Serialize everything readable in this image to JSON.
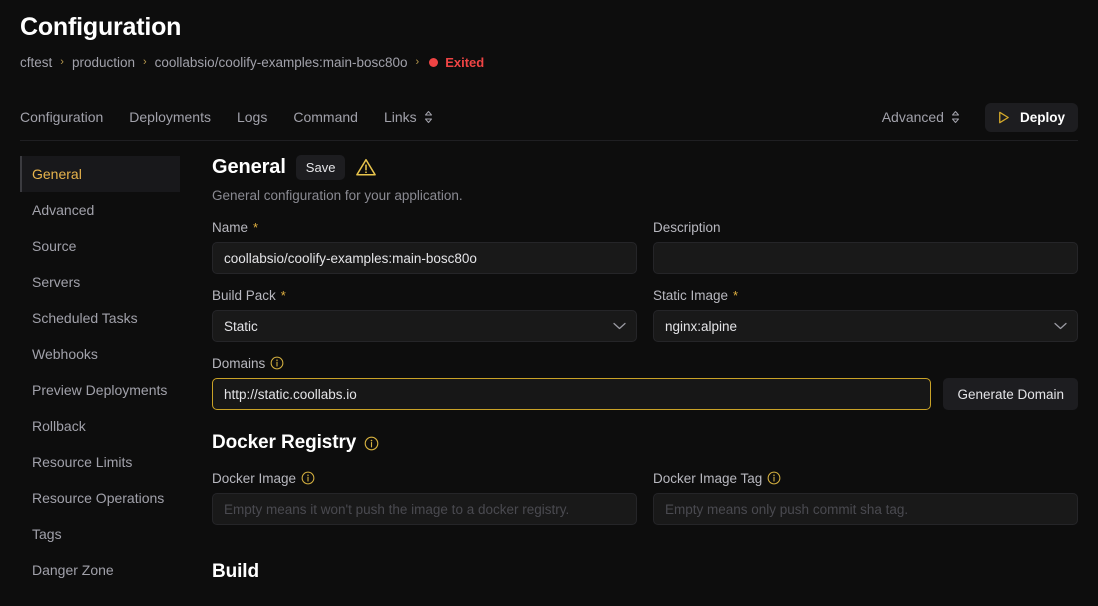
{
  "header": {
    "title": "Configuration",
    "breadcrumb": [
      {
        "label": "cftest"
      },
      {
        "label": "production"
      },
      {
        "label": "coollabsio/coolify-examples:main-bosc80o"
      }
    ],
    "separator": "›",
    "status": {
      "label": "Exited",
      "color": "#ef4444"
    }
  },
  "tabbar": {
    "tabs": [
      {
        "label": "Configuration",
        "active": true
      },
      {
        "label": "Deployments",
        "active": false
      },
      {
        "label": "Logs",
        "active": false
      },
      {
        "label": "Command",
        "active": false
      },
      {
        "label": "Links",
        "active": false,
        "icon": "chevron-updown-icon"
      }
    ],
    "advanced": {
      "label": "Advanced",
      "icon": "chevron-updown-icon"
    },
    "deploy": {
      "label": "Deploy",
      "icon": "play-icon",
      "icon_color": "#d4a92a"
    }
  },
  "sidebar": {
    "items": [
      {
        "label": "General",
        "active": true
      },
      {
        "label": "Advanced",
        "active": false
      },
      {
        "label": "Source",
        "active": false
      },
      {
        "label": "Servers",
        "active": false
      },
      {
        "label": "Scheduled Tasks",
        "active": false
      },
      {
        "label": "Webhooks",
        "active": false
      },
      {
        "label": "Preview Deployments",
        "active": false
      },
      {
        "label": "Rollback",
        "active": false
      },
      {
        "label": "Resource Limits",
        "active": false
      },
      {
        "label": "Resource Operations",
        "active": false
      },
      {
        "label": "Tags",
        "active": false
      },
      {
        "label": "Danger Zone",
        "active": false
      }
    ],
    "active_color": "#e8b44c"
  },
  "general": {
    "heading": "General",
    "save_label": "Save",
    "warning_icon": "warning-triangle-icon",
    "warning_color": "#e8c44c",
    "description": "General configuration for your application.",
    "name": {
      "label": "Name",
      "required": "*",
      "value": "coollabsio/coolify-examples:main-bosc80o",
      "placeholder": ""
    },
    "description_field": {
      "label": "Description",
      "value": "",
      "placeholder": ""
    },
    "build_pack": {
      "label": "Build Pack",
      "required": "*",
      "value": "Static"
    },
    "static_image": {
      "label": "Static Image",
      "required": "*",
      "value": "nginx:alpine"
    },
    "domains": {
      "label": "Domains",
      "info_icon": "info-circle-icon",
      "value": "http://static.coollabs.io",
      "placeholder": "",
      "focused": true,
      "focus_color": "#c9a227",
      "generate_label": "Generate Domain"
    }
  },
  "docker_registry": {
    "heading": "Docker Registry",
    "info_icon": "info-circle-icon",
    "docker_image": {
      "label": "Docker Image",
      "info_icon": "info-circle-icon",
      "value": "",
      "placeholder": "Empty means it won't push the image to a docker registry."
    },
    "docker_image_tag": {
      "label": "Docker Image Tag",
      "info_icon": "info-circle-icon",
      "value": "",
      "placeholder": "Empty means only push commit sha tag."
    }
  },
  "build": {
    "heading": "Build"
  }
}
